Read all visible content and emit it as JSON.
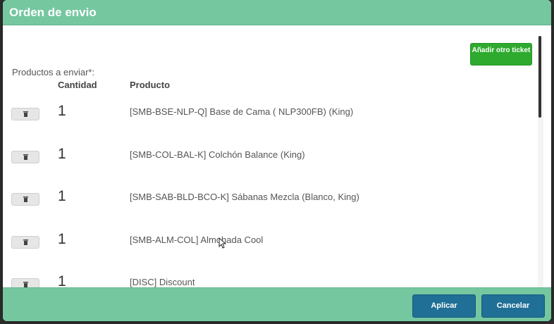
{
  "modal": {
    "title": "Orden de envio",
    "add_ticket_label": "Añadir otro ticket",
    "section_label": "Productos a enviar*:",
    "columns": {
      "quantity": "Cantidad",
      "product": "Producto"
    },
    "rows": [
      {
        "quantity": "1",
        "product": "[SMB-BSE-NLP-Q] Base de Cama ( NLP300FB) (King)"
      },
      {
        "quantity": "1",
        "product": "[SMB-COL-BAL-K] Colchón Balance (King)"
      },
      {
        "quantity": "1",
        "product": "[SMB-SAB-BLD-BCO-K] Sábanas Mezcla (Blanco, King)"
      },
      {
        "quantity": "1",
        "product": "[SMB-ALM-COL] Almohada Cool"
      },
      {
        "quantity": "1",
        "product": "[DISC] Discount"
      }
    ],
    "footer": {
      "apply_label": "Aplicar",
      "cancel_label": "Cancelar"
    }
  },
  "colors": {
    "header": "#75c7a0",
    "add_button": "#2eaa2e",
    "footer_button": "#1f6f96"
  },
  "icons": {
    "delete": "trash-icon",
    "pointer": "mouse-cursor-icon"
  }
}
